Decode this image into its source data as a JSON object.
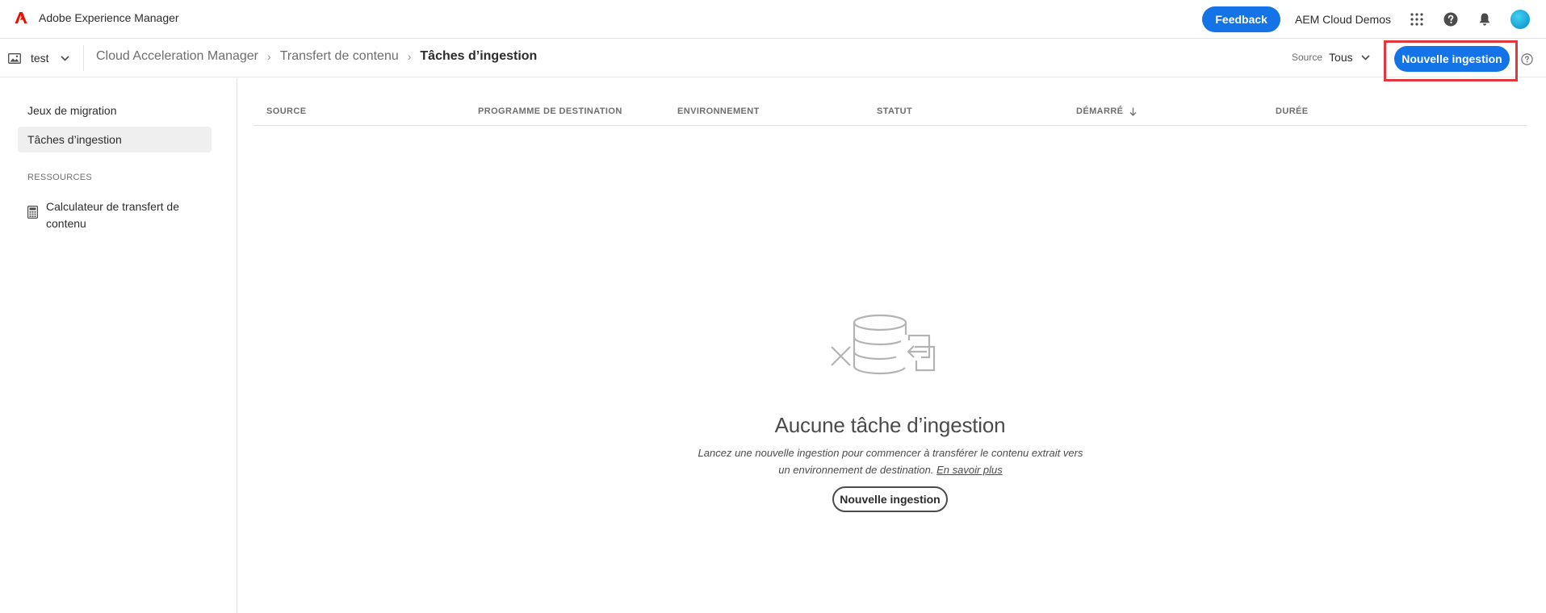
{
  "header": {
    "app_name": "Adobe Experience Manager",
    "feedback_label": "Feedback",
    "org_name": "AEM Cloud Demos",
    "brand_color": "#eb1000",
    "accent_color": "#1473e6",
    "icons": [
      "apps-grid-icon",
      "help-icon",
      "bell-icon",
      "avatar"
    ]
  },
  "subbar": {
    "project_name": "test",
    "breadcrumb": [
      "Cloud Acceleration Manager",
      "Transfert de contenu",
      "Tâches d’ingestion"
    ],
    "source_label": "Source",
    "source_value": "Tous",
    "new_ingestion_label": "Nouvelle ingestion",
    "highlight_color": "#e0383e"
  },
  "sidebar": {
    "items": [
      {
        "label": "Jeux de migration",
        "active": false
      },
      {
        "label": "Tâches d’ingestion",
        "active": true
      }
    ],
    "resources_heading": "RESSOURCES",
    "calculator_label": "Calculateur de transfert de contenu"
  },
  "table": {
    "columns": [
      "SOURCE",
      "PROGRAMME DE DESTINATION",
      "ENVIRONNEMENT",
      "STATUT",
      "DÉMARRÉ",
      "DURÉE"
    ],
    "sorted_column": "DÉMARRÉ",
    "sort_direction": "descending",
    "rows": []
  },
  "empty_state": {
    "title": "Aucune tâche d’ingestion",
    "description": "Lancez une nouvelle ingestion pour commencer à transférer le contenu extrait vers un environnement de destination.",
    "learn_more": "En savoir plus",
    "button_label": "Nouvelle ingestion"
  }
}
